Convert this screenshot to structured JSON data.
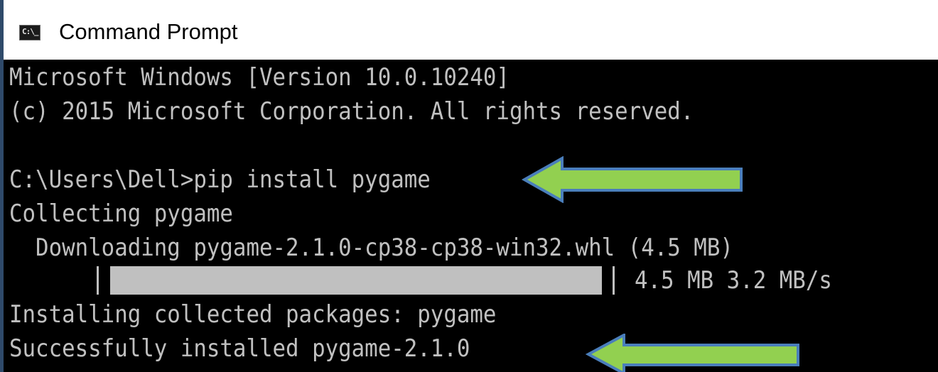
{
  "window": {
    "title": "Command Prompt",
    "icon_text": "C:\\_"
  },
  "console": {
    "lines": [
      "Microsoft Windows [Version 10.0.10240]",
      "(c) 2015 Microsoft Corporation. All rights reserved.",
      "",
      "C:\\Users\\Dell>pip install pygame",
      "Collecting pygame",
      "  Downloading pygame-2.1.0-cp38-cp38-win32.whl (4.5 MB)",
      "Installing collected packages: pygame",
      "Successfully installed pygame-2.1.0"
    ],
    "progress": {
      "fraction": 1.0,
      "text": "4.5 MB 3.2 MB/s"
    }
  },
  "colors": {
    "console_bg": "#000000",
    "console_text": "#c0c0c0",
    "arrow_fill": "#92d050",
    "arrow_stroke": "#4a7ebb"
  },
  "icons": [
    "console-app-icon",
    "left-arrow-icon"
  ]
}
